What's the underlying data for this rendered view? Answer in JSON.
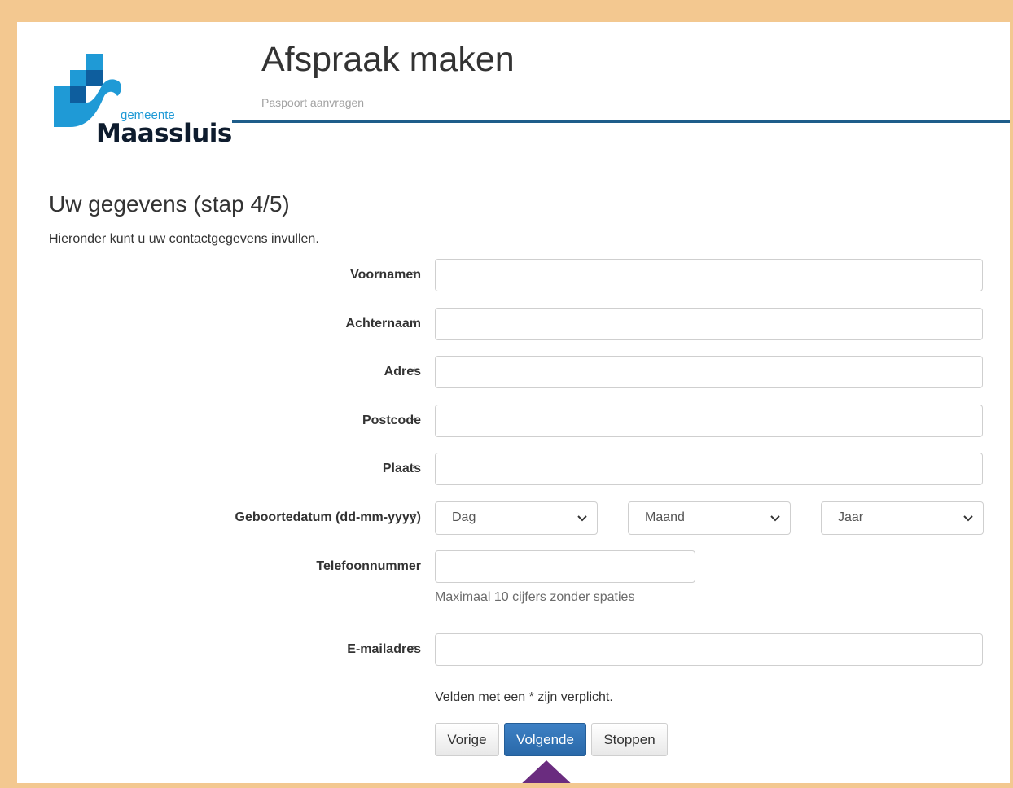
{
  "header": {
    "title": "Afspraak maken",
    "subtitle": "Paspoort aanvragen",
    "logo_small": "gemeente",
    "logo_big": "Maassluis"
  },
  "step": {
    "title": "Uw gegevens (stap 4/5)",
    "intro": "Hieronder kunt u uw contactgegevens invullen."
  },
  "form": {
    "required_marker": "*",
    "voornamen_label": "Voornamen",
    "achternaam_label": "Achternaam",
    "adres_label": "Adres",
    "postcode_label": "Postcode",
    "plaats_label": "Plaats",
    "geboortedatum_label": "Geboortedatum (dd-mm-yyyy)",
    "dag": "Dag",
    "maand": "Maand",
    "jaar": "Jaar",
    "telefoon_label": "Telefoonnummer",
    "telefoon_help": "Maximaal 10 cijfers zonder spaties",
    "email_label": "E-mailadres",
    "required_note": "Velden met een * zijn verplicht."
  },
  "buttons": {
    "vorige": "Vorige",
    "volgende": "Volgende",
    "stoppen": "Stoppen"
  },
  "colors": {
    "page_border": "#f3c890",
    "header_rule": "#1e5d8a",
    "primary_button": "#2a69a9",
    "pointer": "#6a2c7f",
    "logo_blue": "#1f9ad6"
  }
}
